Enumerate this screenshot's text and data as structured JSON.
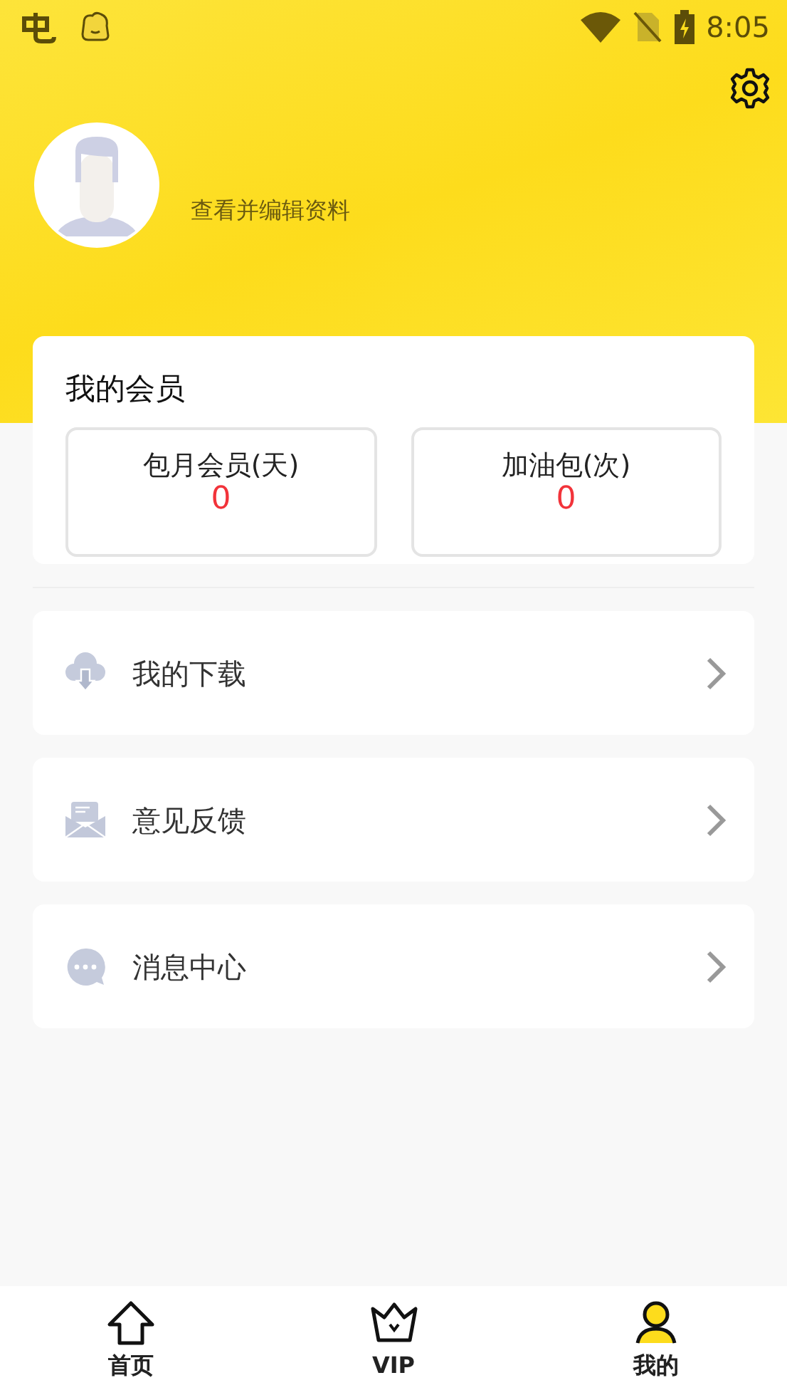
{
  "status_bar": {
    "time": "8:05"
  },
  "profile": {
    "edit_link": "查看并编辑资料"
  },
  "membership": {
    "title": "我的会员",
    "stats": [
      {
        "label": "包月会员(天)",
        "value": "0"
      },
      {
        "label": "加油包(次)",
        "value": "0"
      }
    ]
  },
  "menu": [
    {
      "kind": "download",
      "label": "我的下载"
    },
    {
      "kind": "feedback",
      "label": "意见反馈"
    },
    {
      "kind": "messages",
      "label": "消息中心"
    }
  ],
  "tabs": [
    {
      "kind": "home",
      "label": "首页",
      "selected": false
    },
    {
      "kind": "vip",
      "label": "VIP",
      "selected": false
    },
    {
      "kind": "me",
      "label": "我的",
      "selected": true
    }
  ]
}
